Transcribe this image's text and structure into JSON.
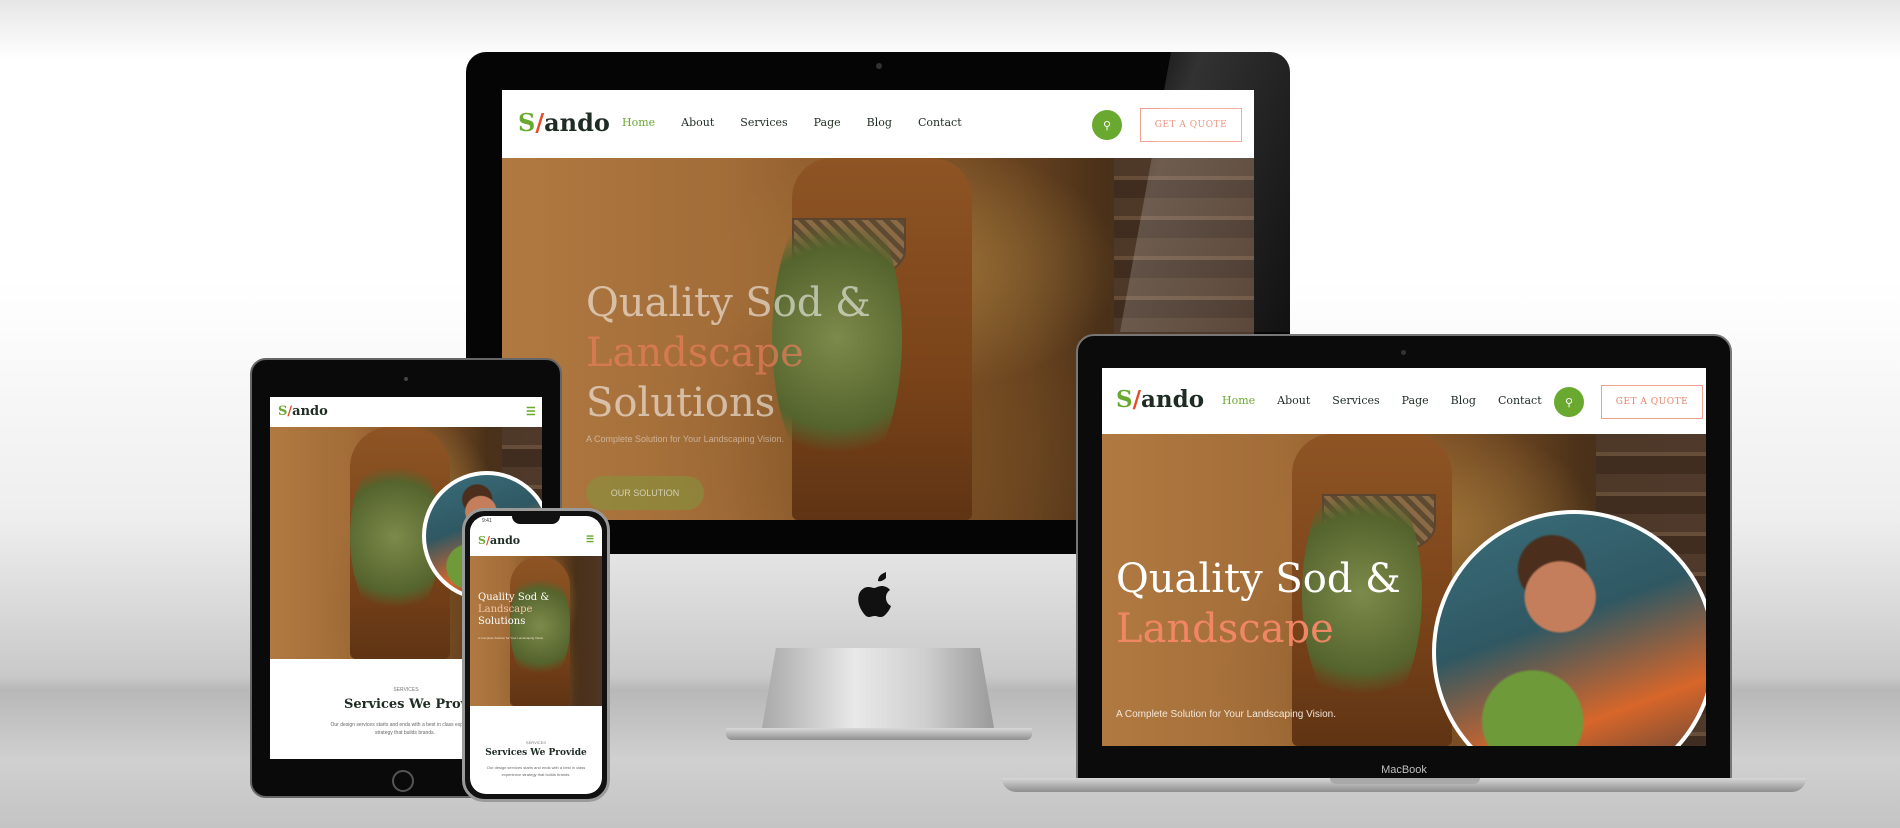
{
  "site": {
    "logo": {
      "s": "S",
      "slash": "/",
      "rest": "ando"
    },
    "nav": [
      "Home",
      "About",
      "Services",
      "Page",
      "Blog",
      "Contact"
    ],
    "active_nav": "Home",
    "quote_button": "GET A QUOTE",
    "hero": {
      "line1": "Quality Sod &",
      "line2": "Landscape",
      "line3": "Solutions",
      "subtitle": "A Complete Solution for Your Landscaping Vision.",
      "cta": "OUR SOLUTION"
    },
    "services": {
      "kicker": "SERVICES",
      "title": "Services We Provide",
      "title_cropped": "Services We Provid",
      "desc": "Our design services starts and ends with a best in class experience strategy that builds brands."
    }
  },
  "devices": {
    "laptop_label": "MacBook",
    "phone_time": "9:41"
  },
  "colors": {
    "green": "#6aa930",
    "orange": "#e24d2a",
    "dark": "#1e2c23"
  },
  "icons": [
    "search-icon",
    "apple-logo-icon",
    "hamburger-menu-icon"
  ]
}
